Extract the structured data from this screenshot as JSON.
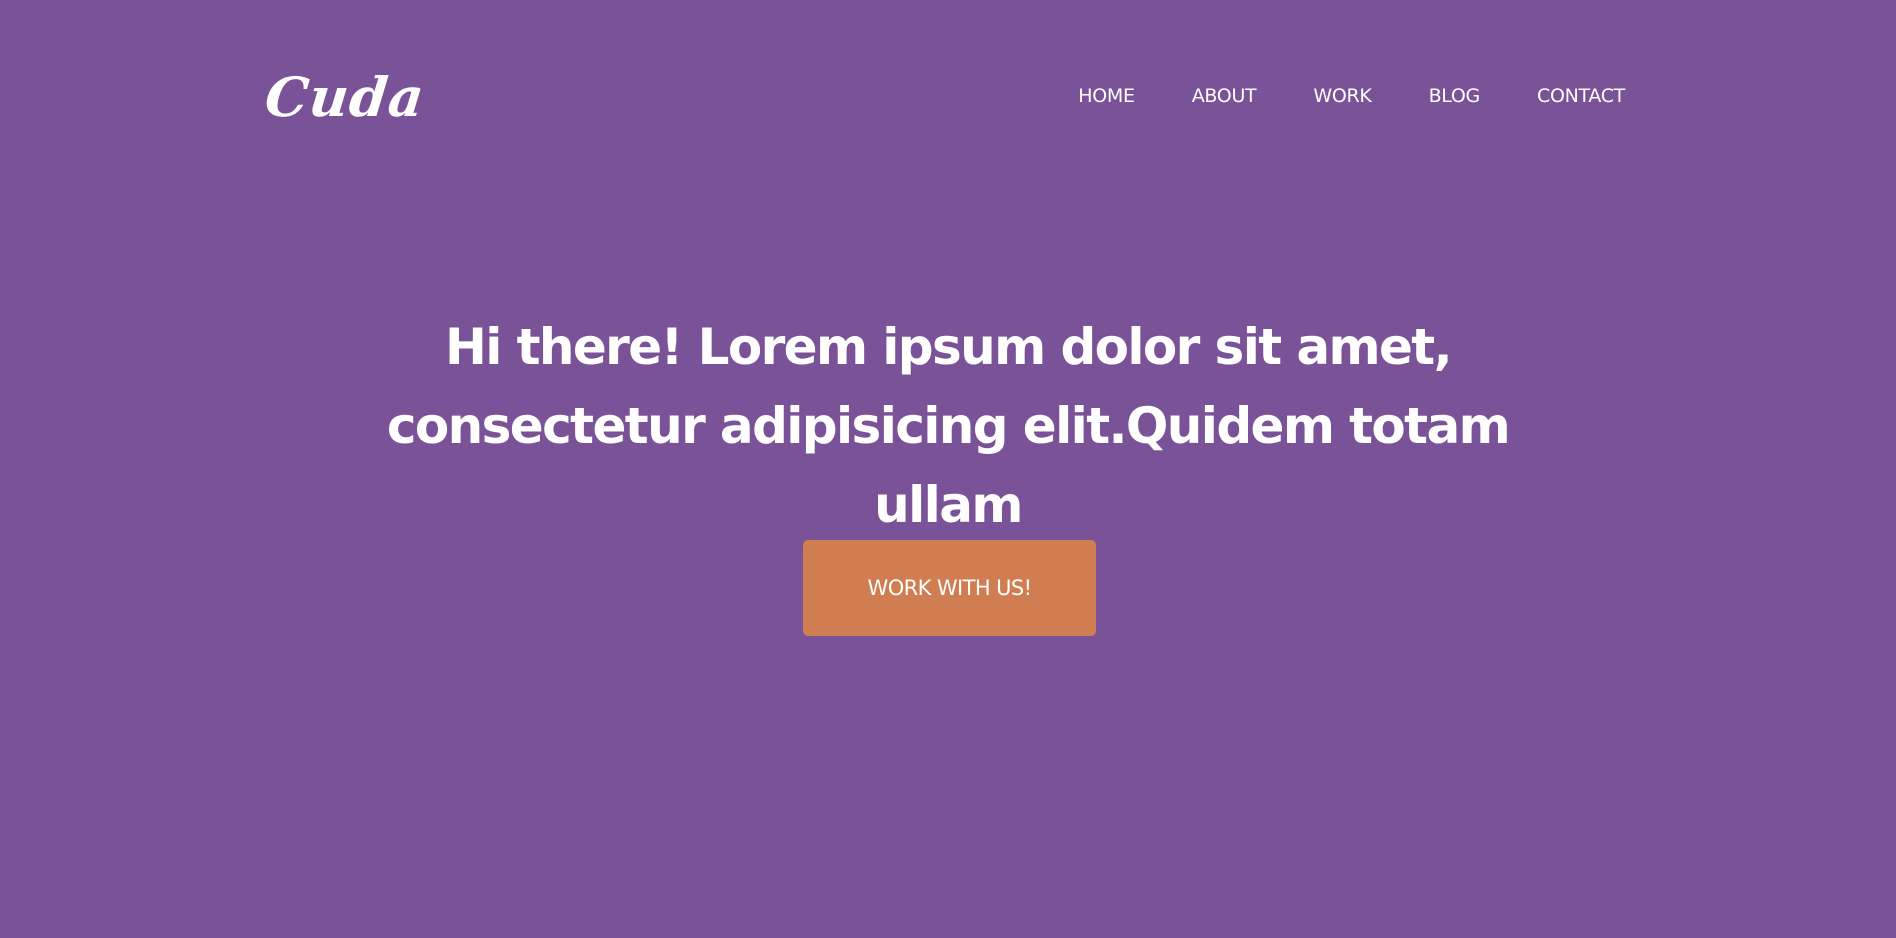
{
  "brand": {
    "logo_text": "Cuda"
  },
  "nav": {
    "items": [
      {
        "label": "HOME"
      },
      {
        "label": "ABOUT"
      },
      {
        "label": "WORK"
      },
      {
        "label": "BLOG"
      },
      {
        "label": "CONTACT"
      }
    ]
  },
  "hero": {
    "title": "Hi there! Lorem ipsum dolor sit amet, consectetur adipisicing elit.Quidem totam ullam",
    "cta_label": "WORK WITH US!"
  },
  "colors": {
    "background": "#7a5298",
    "accent": "#d17d52",
    "text": "#ffffff"
  }
}
